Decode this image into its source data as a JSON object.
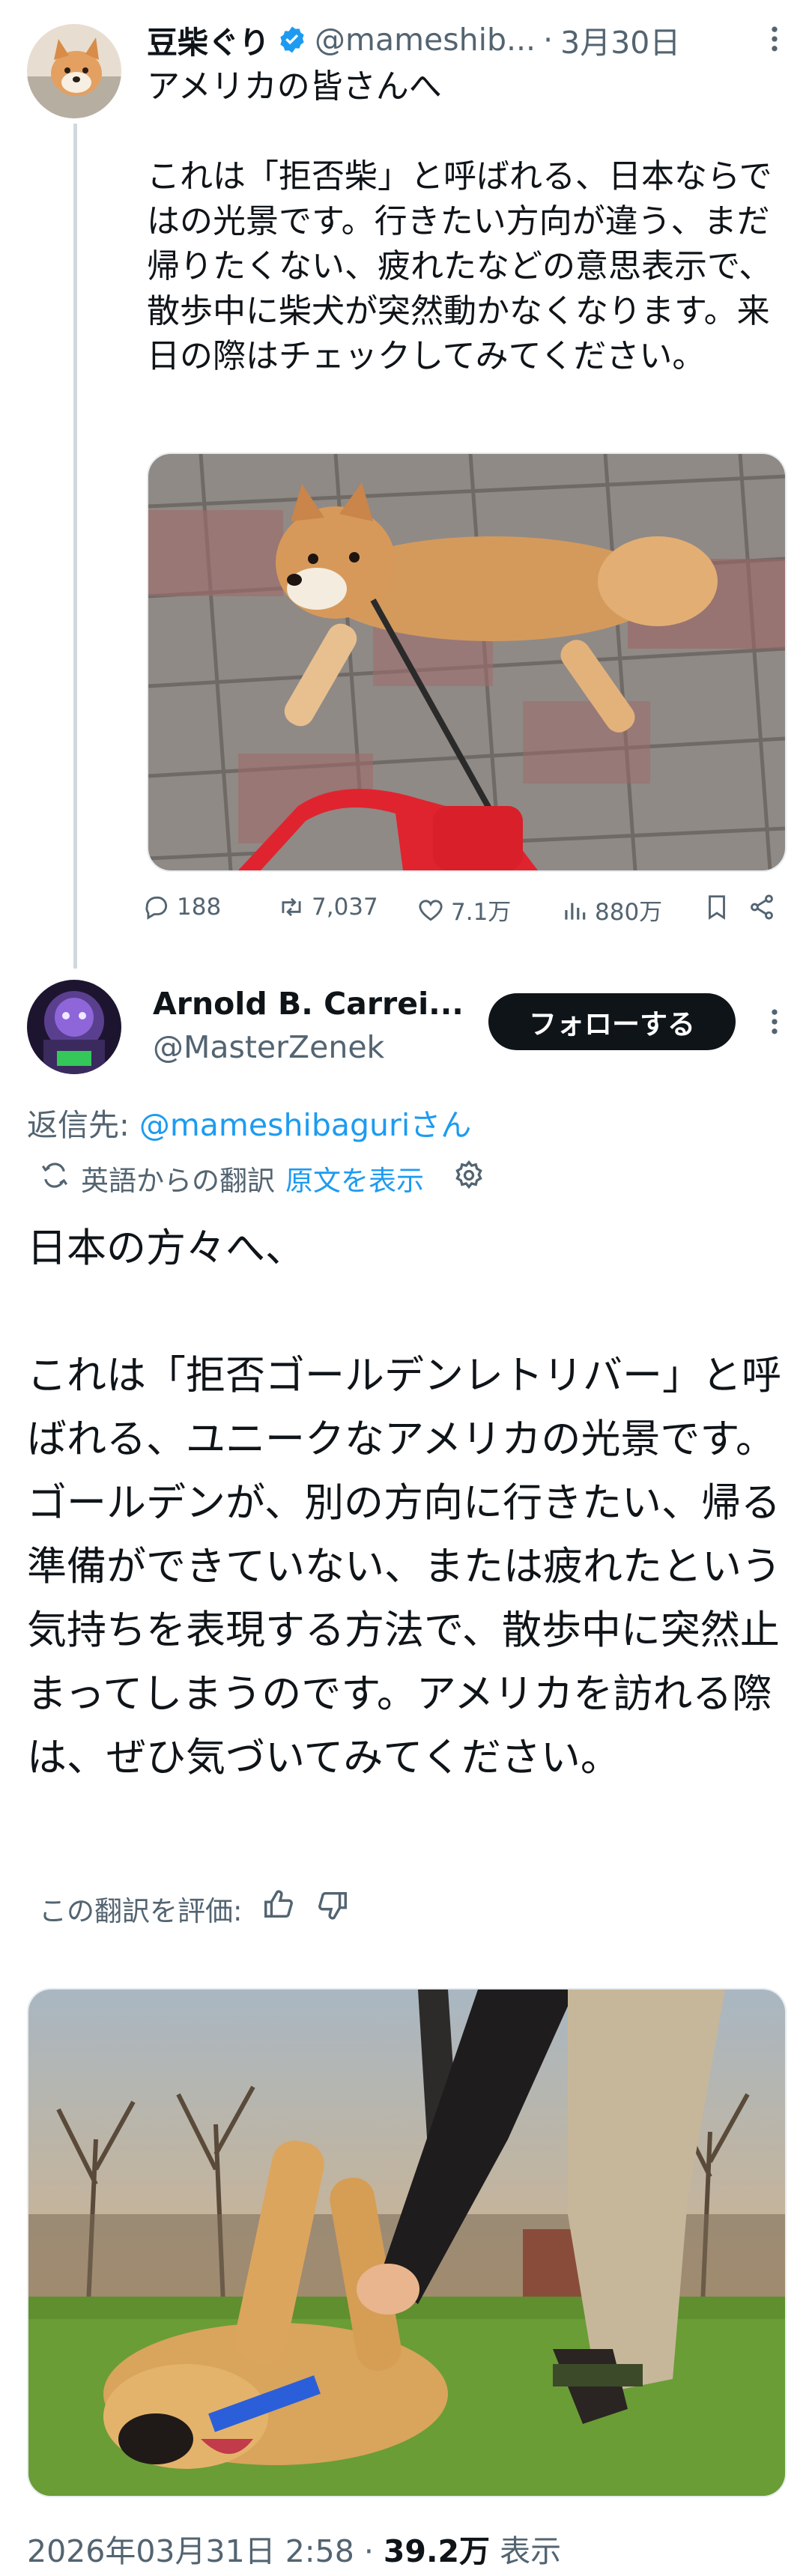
{
  "tweet": {
    "author": {
      "name": "豆柴ぐり",
      "handle": "@mameshib...",
      "verified": true
    },
    "separator": "·",
    "date": "3月30日",
    "more_icon": "more-horizontal-icon",
    "text": "アメリカの皆さんへ\n\nこれは「拒否柴」と呼ばれる、日本ならではの光景です。行きたい方向が違う、まだ帰りたくない、疲れたなどの意思表示で、散歩中に柴犬が突然動かなくなります。来日の際はチェックしてみてください。",
    "image_alt": "Shiba Inu lying on brick pavement refusing to walk, red leash",
    "metrics": {
      "replies": "188",
      "retweets": "7,037",
      "likes": "7.1万",
      "views": "880万"
    }
  },
  "reply": {
    "author": {
      "name": "Arnold B. Carrei...",
      "handle": "@MasterZenek"
    },
    "follow_label": "フォローする",
    "reply_to_prefix": "返信先: ",
    "reply_to_handle": "@mameshibaguriさん",
    "translated_from": "英語からの翻訳",
    "show_original": "原文を表示",
    "text": "日本の方々へ、\n\nこれは「拒否ゴールデンレトリバー」と呼ばれる、ユニークなアメリカの光景です。ゴールデンが、別の方向に行きたい、帰る準備ができていない、または疲れたという気持ちを表現する方法で、散歩中に突然止まってしまうのです。アメリカを訪れる際は、ぜひ気づいてみてください。",
    "rate_translation_label": "この翻訳を評価:",
    "image_alt": "Golden retriever rolling on grass refusing to walk",
    "timestamp": "2026年03月31日 2:58 · ",
    "views_count": "39.2万",
    "views_label": " 表示"
  },
  "colors": {
    "accent": "#1d9bf0",
    "text": "#0f1419",
    "muted": "#536471",
    "line": "#cfd9de",
    "leash": "#e0242f"
  }
}
